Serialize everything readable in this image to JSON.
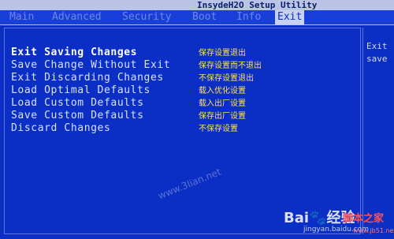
{
  "header": {
    "title": "InsydeH2O Setup Utility"
  },
  "tabs": [
    {
      "label": "Main"
    },
    {
      "label": "Advanced"
    },
    {
      "label": "Security"
    },
    {
      "label": "Boot"
    },
    {
      "label": "Info"
    },
    {
      "label": "Exit"
    }
  ],
  "active_tab": "Exit",
  "help_panel": {
    "line1": "Exit",
    "line2": "save"
  },
  "menu": {
    "items": [
      {
        "label": "Exit Saving Changes",
        "note": "保存设置退出"
      },
      {
        "label": "Save Change Without Exit",
        "note": "保存设置而不退出"
      },
      {
        "label": "Exit Discarding Changes",
        "note": "不保存设置退出"
      },
      {
        "label": "Load Optimal Defaults",
        "note": "载入优化设置"
      },
      {
        "label": "Load Custom Defaults",
        "note": "载入出厂设置"
      },
      {
        "label": "Save Custom Defaults",
        "note": "保存出厂设置"
      },
      {
        "label": "Discard Changes",
        "note": "不保存设置"
      }
    ]
  },
  "watermarks": {
    "site1": "www.3lian.net",
    "baidu": "Bai🐾经验",
    "baidu_url": "jingyan.baidu.com",
    "jb51": "脚本之家",
    "jb51_url": "www.jb51.net"
  }
}
